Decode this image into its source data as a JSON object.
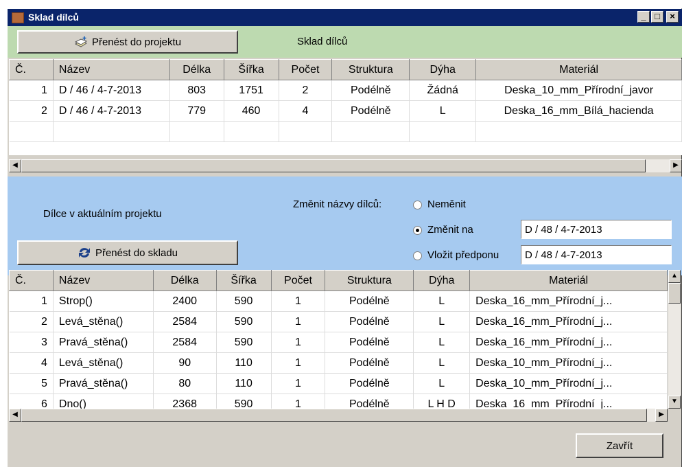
{
  "window": {
    "title": "Sklad dílců",
    "controls": [
      "_",
      "□",
      "×"
    ]
  },
  "top": {
    "transfer_button": "Přenést do projektu",
    "section_title": "Sklad dílců"
  },
  "table1": {
    "headers": [
      "Č.",
      "Název",
      "Délka",
      "Šířka",
      "Počet",
      "Struktura",
      "Dýha",
      "Materiál"
    ],
    "rows": [
      [
        "1",
        "D / 46 / 4-7-2013",
        "803",
        "1751",
        "2",
        "Podélně",
        "Žádná",
        "Deska_10_mm_Přírodní_javor"
      ],
      [
        "2",
        "D / 46 / 4-7-2013",
        "779",
        "460",
        "4",
        "Podélně",
        "L",
        "Deska_16_mm_Bílá_hacienda"
      ]
    ]
  },
  "middle": {
    "project_label": "Dílce v aktuálním projektu",
    "rename_label": "Změnit názvy dílců:",
    "options": [
      "Neměnit",
      "Změnit na",
      "Vložit předponu"
    ],
    "selected": 1,
    "rename_value": "D / 48 / 4-7-2013",
    "prefix_value": "D / 48 / 4-7-2013",
    "transfer_button": "Přenést do skladu"
  },
  "table2": {
    "headers": [
      "Č.",
      "Název",
      "Délka",
      "Šířka",
      "Počet",
      "Struktura",
      "Dýha",
      "Materiál"
    ],
    "rows": [
      [
        "1",
        "Strop()",
        "2400",
        "590",
        "1",
        "Podélně",
        "L",
        "Deska_16_mm_Přírodní_j..."
      ],
      [
        "2",
        "Levá_stěna()",
        "2584",
        "590",
        "1",
        "Podélně",
        "L",
        "Deska_16_mm_Přírodní_j..."
      ],
      [
        "3",
        "Pravá_stěna()",
        "2584",
        "590",
        "1",
        "Podélně",
        "L",
        "Deska_16_mm_Přírodní_j..."
      ],
      [
        "4",
        "Levá_stěna()",
        "90",
        "110",
        "1",
        "Podélně",
        "L",
        "Deska_10_mm_Přírodní_j..."
      ],
      [
        "5",
        "Pravá_stěna()",
        "80",
        "110",
        "1",
        "Podélně",
        "L",
        "Deska_10_mm_Přírodní_j..."
      ],
      [
        "6",
        "Dno()",
        "2368",
        "590",
        "1",
        "Podélně",
        "L H D",
        "Deska_16_mm_Přírodní_j..."
      ]
    ]
  },
  "footer": {
    "close_button": "Zavřít"
  }
}
